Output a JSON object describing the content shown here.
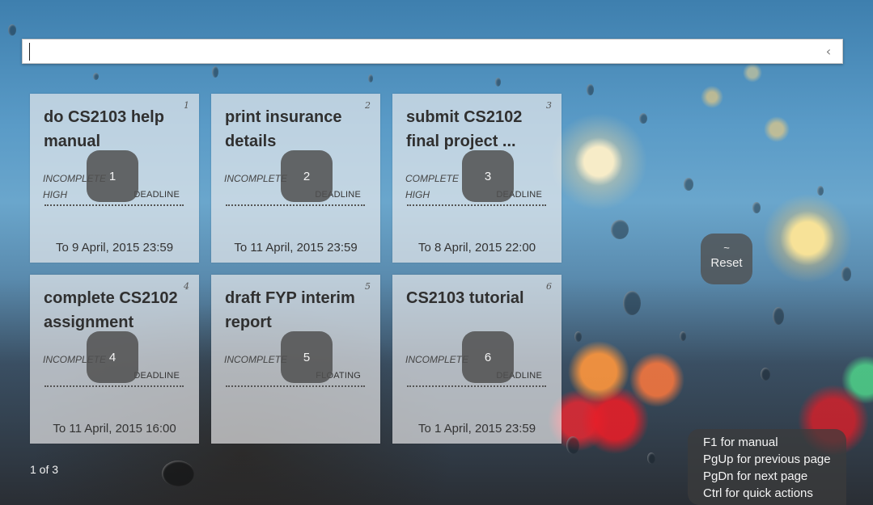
{
  "search": {
    "value": "",
    "placeholder": ""
  },
  "tasks": [
    {
      "index": "1",
      "title": "do CS2103 help manual",
      "status": "INCOMPLETE",
      "priority": "HIGH",
      "type": "DEADLINE",
      "date": "To 9 April, 2015 23:59",
      "badge": "1"
    },
    {
      "index": "2",
      "title": "print insurance details",
      "status": "INCOMPLETE",
      "priority": "",
      "type": "DEADLINE",
      "date": "To 11 April, 2015 23:59",
      "badge": "2"
    },
    {
      "index": "3",
      "title": "submit CS2102 final project ...",
      "status": "COMPLETE",
      "priority": "HIGH",
      "type": "DEADLINE",
      "date": "To 8 April, 2015 22:00",
      "badge": "3"
    },
    {
      "index": "4",
      "title": "complete CS2102 assignment",
      "status": "INCOMPLETE",
      "priority": "",
      "type": "DEADLINE",
      "date": "To 11 April, 2015 16:00",
      "badge": "4"
    },
    {
      "index": "5",
      "title": "draft FYP interim report",
      "status": "INCOMPLETE",
      "priority": "",
      "type": "FLOATING",
      "date": "",
      "badge": "5"
    },
    {
      "index": "6",
      "title": "CS2103 tutorial",
      "status": "INCOMPLETE",
      "priority": "",
      "type": "DEADLINE",
      "date": "To 1 April, 2015 23:59",
      "badge": "6"
    }
  ],
  "reset": {
    "symbol": "~",
    "label": "Reset"
  },
  "pagination": {
    "text": "1 of 3"
  },
  "help": {
    "lines": [
      "F1 for manual",
      "PgUp for previous page",
      "PgDn for next page",
      "Ctrl for quick actions"
    ]
  },
  "icons": {
    "collapse": "chevron-left-icon"
  }
}
